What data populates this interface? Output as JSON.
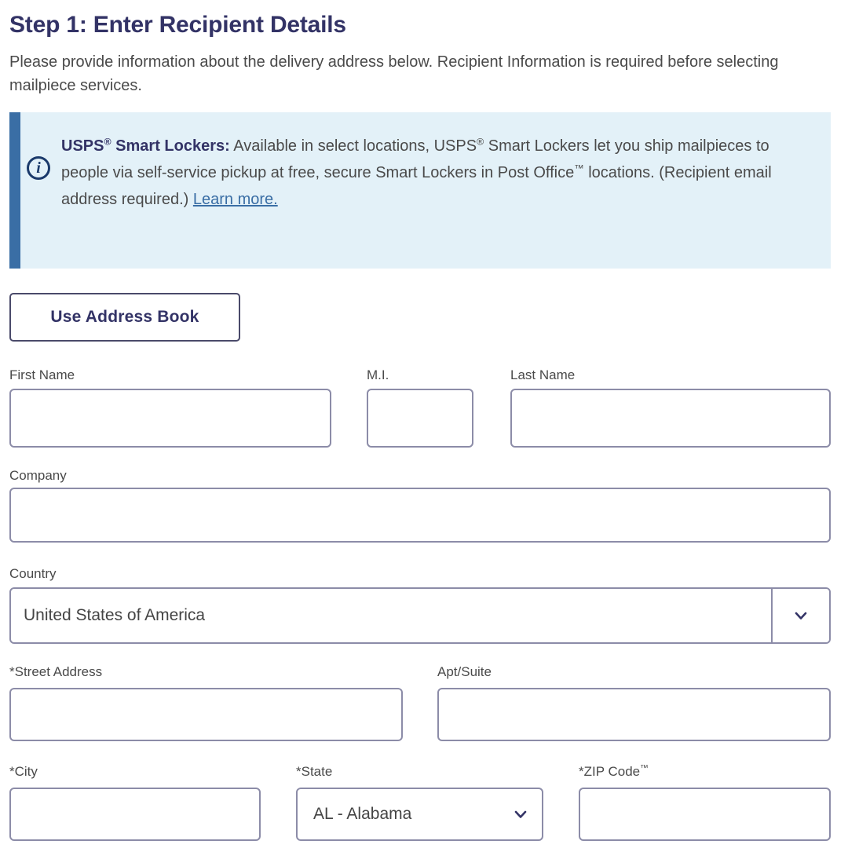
{
  "heading": "Step 1: Enter Recipient Details",
  "intro": "Please provide information about the delivery address below. Recipient Information is required before selecting mailpiece services.",
  "info_banner": {
    "icon": "info-circle-icon",
    "lead": "USPS",
    "lead_sup": "®",
    "lead_rest": " Smart Lockers:",
    "body_1": " Available in select locations, USPS",
    "body_sup_1": "®",
    "body_2": " Smart Lockers let you ship mailpieces to people via self-service pickup at free, secure Smart Lockers in Post Office",
    "body_sup_2": "™",
    "body_3": " locations. (Recipient email address required.) ",
    "link": "Learn more.",
    "accent_color": "#3a6ea5",
    "background_color": "#e3f1f8"
  },
  "address_book_button": "Use Address Book",
  "fields": {
    "first_name": {
      "label": "First Name",
      "value": "",
      "placeholder": ""
    },
    "middle_initial": {
      "label": "M.I.",
      "value": "",
      "placeholder": ""
    },
    "last_name": {
      "label": "Last Name",
      "value": "",
      "placeholder": ""
    },
    "company": {
      "label": "Company",
      "value": "",
      "placeholder": ""
    },
    "country": {
      "label": "Country",
      "value": "United States of America"
    },
    "street_address": {
      "label": "*Street Address",
      "value": "",
      "placeholder": ""
    },
    "apt_suite": {
      "label": "Apt/Suite",
      "value": "",
      "placeholder": ""
    },
    "city": {
      "label": "*City",
      "value": "",
      "placeholder": ""
    },
    "state": {
      "label": "*State",
      "value": "AL - Alabama"
    },
    "zip_code": {
      "label": "*ZIP Code",
      "label_sup": "™",
      "value": "",
      "placeholder": ""
    }
  },
  "colors": {
    "heading": "#333366",
    "text": "#4a4a4a",
    "field_border": "#8c8ca8",
    "link": "#3a6ea5"
  }
}
